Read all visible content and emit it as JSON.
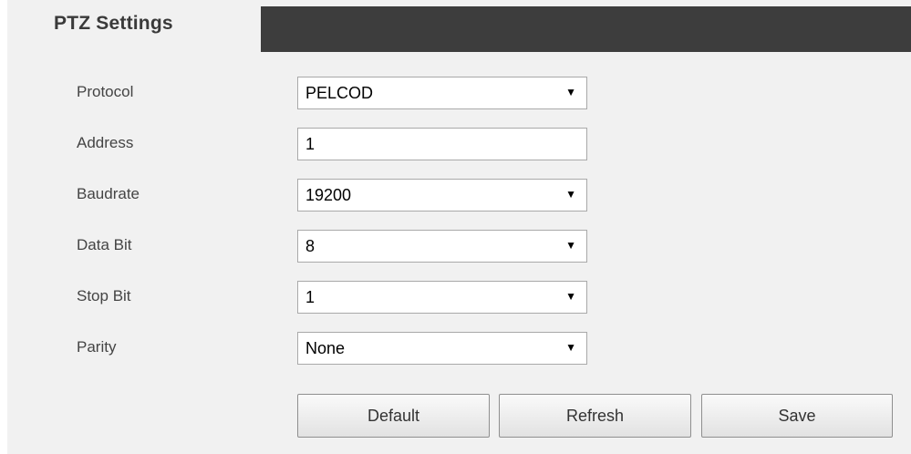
{
  "header": {
    "active_tab": "PTZ Settings"
  },
  "form": {
    "protocol": {
      "label": "Protocol",
      "value": "PELCOD"
    },
    "address": {
      "label": "Address",
      "value": "1"
    },
    "baudrate": {
      "label": "Baudrate",
      "value": "19200"
    },
    "data_bit": {
      "label": "Data Bit",
      "value": "8"
    },
    "stop_bit": {
      "label": "Stop Bit",
      "value": "1"
    },
    "parity": {
      "label": "Parity",
      "value": "None"
    }
  },
  "buttons": {
    "default": "Default",
    "refresh": "Refresh",
    "save": "Save"
  },
  "icons": {
    "dropdown": "chevron-down-icon"
  },
  "colors": {
    "tab_bar": "#3d3d3d",
    "panel_background": "#f1f1f1"
  }
}
